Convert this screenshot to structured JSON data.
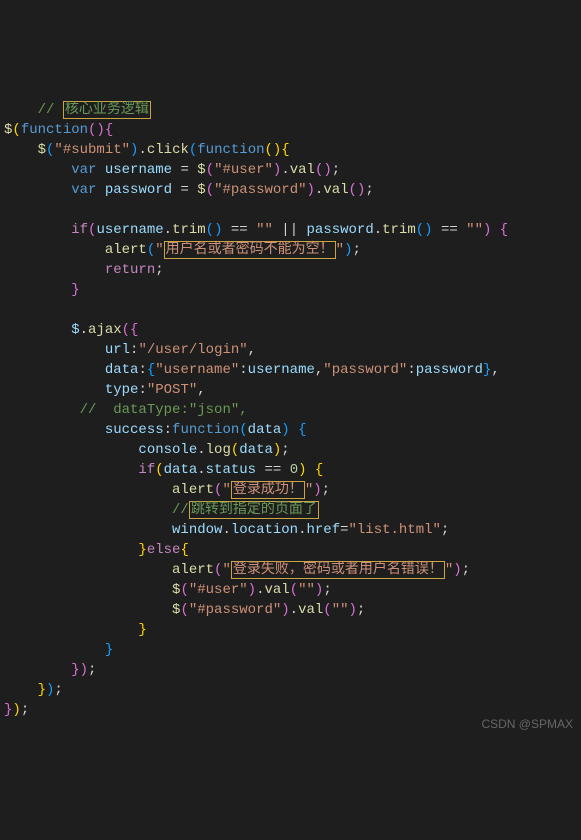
{
  "lines": {
    "l1_comment": "//",
    "l1_text": "核心业务逻辑",
    "l2_dollar": "$",
    "l2_fn": "function",
    "l3_dollar": "$",
    "l3_sel": "\"#submit\"",
    "l3_click": "click",
    "l3_fn": "function",
    "l4_var": "var",
    "l4_username": "username",
    "l4_eq": " = ",
    "l4_dollar": "$",
    "l4_sel": "\"#user\"",
    "l4_val": "val",
    "l5_var": "var",
    "l5_password": "password",
    "l5_eq": " = ",
    "l5_dollar": "$",
    "l5_sel": "\"#password\"",
    "l5_val": "val",
    "l7_if": "if",
    "l7_username": "username",
    "l7_trim": "trim",
    "l7_eqeq": " == ",
    "l7_empty": "\"\"",
    "l7_or": " || ",
    "l7_password": "password",
    "l8_alert": "alert",
    "l8_q1": "\"",
    "l8_text": "用户名或者密码不能为空！",
    "l8_q2": "\"",
    "l9_return": "return",
    "l12_dollar": "$",
    "l12_ajax": "ajax",
    "l13_url": "url",
    "l13_val": "\"/user/login\"",
    "l14_data": "data",
    "l14_k1": "\"username\"",
    "l14_v1": "username",
    "l14_k2": "\"password\"",
    "l14_v2": "password",
    "l15_type": "type",
    "l15_val": "\"POST\"",
    "l16_comment": "//  dataType:\"json\",",
    "l17_success": "success",
    "l17_fn": "function",
    "l17_data": "data",
    "l18_console": "console",
    "l18_log": "log",
    "l18_data": "data",
    "l19_if": "if",
    "l19_data": "data",
    "l19_status": "status",
    "l19_eqeq": " == ",
    "l19_zero": "0",
    "l20_alert": "alert",
    "l20_q1": "\"",
    "l20_text": "登录成功！",
    "l20_q2": "\"",
    "l21_comment": "//",
    "l21_text": "跳转到指定的页面了",
    "l22_window": "window",
    "l22_location": "location",
    "l22_href": "href",
    "l22_val": "\"list.html\"",
    "l23_else": "else",
    "l24_alert": "alert",
    "l24_q1": "\"",
    "l24_text": "登录失败，密码或者用户名错误！",
    "l24_q2": "\"",
    "l25_dollar": "$",
    "l25_sel": "\"#user\"",
    "l25_val": "val",
    "l25_empty": "\"\"",
    "l26_dollar": "$",
    "l26_sel": "\"#password\"",
    "l26_val": "val",
    "l26_empty": "\"\""
  },
  "watermark": "CSDN @SPMAX"
}
